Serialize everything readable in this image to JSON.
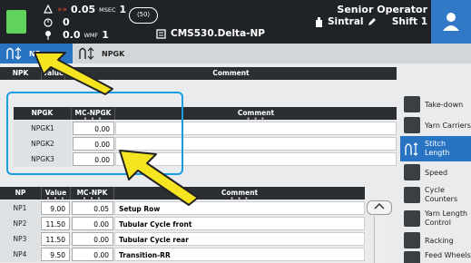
{
  "header": {
    "speed_value": "0.05",
    "speed_unit": "MSEC",
    "speed_right": "1",
    "row2_value": "0",
    "row3_value": "0.0",
    "row3_unit": "WMF",
    "row3_right": "1",
    "device_label": "⟨50⟩",
    "machine_name": "CMS530.Delta-NP",
    "operator": "Senior Operator",
    "company": "Sintral",
    "shift": "Shift 1",
    "status_color": "#5fd35a"
  },
  "tabs": [
    {
      "label": "NP"
    },
    {
      "label": "NPGK"
    }
  ],
  "top_table": {
    "headers": [
      "NPK",
      "Value",
      "Comment"
    ],
    "dots": "• • •"
  },
  "npgk_table": {
    "headers": [
      "NPGK",
      "MC-NPGK",
      "Comment"
    ],
    "rows": [
      {
        "label": "NPGK1",
        "value": "0.00",
        "comment": ""
      },
      {
        "label": "NPGK2",
        "value": "0.00",
        "comment": ""
      },
      {
        "label": "NPGK3",
        "value": "0.00",
        "comment": ""
      }
    ]
  },
  "np_table": {
    "headers": [
      "NP",
      "Value",
      "MC-NPK",
      "Comment"
    ],
    "rows": [
      {
        "label": "NP1",
        "value": "9.00",
        "mc": "0.05",
        "comment": "Setup Row"
      },
      {
        "label": "NP2",
        "value": "11.50",
        "mc": "0.00",
        "comment": "Tubular Cycle front"
      },
      {
        "label": "NP3",
        "value": "11.50",
        "mc": "0.00",
        "comment": "Tubular Cycle rear"
      },
      {
        "label": "NP4",
        "value": "9.50",
        "mc": "0.00",
        "comment": "Transition-RR"
      }
    ]
  },
  "sidebar": [
    {
      "label": "Take-down",
      "icon": "take-down-icon"
    },
    {
      "label": "Yarn Carriers",
      "icon": "yarn-carriers-icon"
    },
    {
      "label": "Stitch Length",
      "icon": "stitch-length-icon"
    },
    {
      "label": "Speed",
      "icon": "speed-icon"
    },
    {
      "label": "Cycle Counters",
      "icon": "cycle-counters-icon"
    },
    {
      "label": "Yarn Length Control",
      "icon": "yarn-length-icon"
    },
    {
      "label": "Racking",
      "icon": "racking-icon"
    },
    {
      "label": "Feed Wheels",
      "icon": "feed-wheels-icon"
    }
  ],
  "colors": {
    "accent": "#2874c3",
    "highlight": "#1a9ee0",
    "arrow": "#f5e521"
  }
}
